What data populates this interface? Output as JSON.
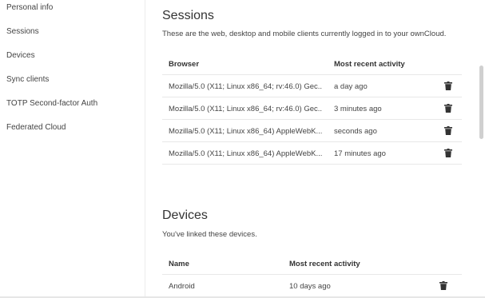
{
  "sidebar": {
    "items": [
      {
        "label": "Personal info"
      },
      {
        "label": "Sessions"
      },
      {
        "label": "Devices"
      },
      {
        "label": "Sync clients"
      },
      {
        "label": "TOTP Second-factor Auth"
      },
      {
        "label": "Federated Cloud"
      }
    ]
  },
  "sessions": {
    "title": "Sessions",
    "description": "These are the web, desktop and mobile clients currently logged in to your ownCloud.",
    "columns": {
      "browser": "Browser",
      "activity": "Most recent activity"
    },
    "rows": [
      {
        "browser": "Mozilla/5.0 (X11; Linux x86_64; rv:46.0) Gec...",
        "activity": "a day ago",
        "delete_icon": "trash-icon"
      },
      {
        "browser": "Mozilla/5.0 (X11; Linux x86_64; rv:46.0) Gec...",
        "activity": "3 minutes ago",
        "delete_icon": "trash-icon"
      },
      {
        "browser": "Mozilla/5.0 (X11; Linux x86_64) AppleWebK...",
        "activity": "seconds ago",
        "delete_icon": "trash-icon"
      },
      {
        "browser": "Mozilla/5.0 (X11; Linux x86_64) AppleWebK...",
        "activity": "17 minutes ago",
        "delete_icon": "trash-icon"
      }
    ]
  },
  "devices": {
    "title": "Devices",
    "description": "You've linked these devices.",
    "columns": {
      "name": "Name",
      "activity": "Most recent activity"
    },
    "rows": [
      {
        "name": "Android",
        "activity": "10 days ago",
        "delete_icon": "trash-icon"
      }
    ]
  }
}
